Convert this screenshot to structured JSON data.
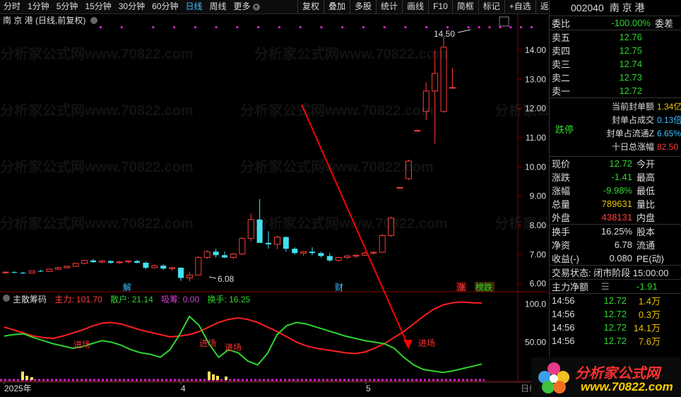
{
  "toolbar": {
    "periods": [
      "分时",
      "1分钟",
      "5分钟",
      "15分钟",
      "30分钟",
      "60分钟",
      "日线",
      "周线",
      "更多"
    ],
    "active_period": "日线",
    "buttons": [
      "复权",
      "叠加",
      "多股",
      "统计",
      "画线",
      "F10",
      "简框",
      "标记",
      "+自选",
      "返回"
    ]
  },
  "chart": {
    "title": "南 京 港 (日线,前复权)",
    "price_ticks": [
      "14.00",
      "13.00",
      "12.00",
      "11.00",
      "10.00",
      "9.00",
      "8.00",
      "7.00",
      "6.00"
    ],
    "high_label": "14.50",
    "low_label": "6.08",
    "markers": [
      "解",
      "财",
      "涨",
      "榜跌"
    ],
    "x_labels": [
      "2025年",
      "4",
      "5",
      "日线"
    ],
    "indicator": {
      "name": "主散筹码",
      "main_force": "主力: 101.70",
      "retail": "散户: 21.14",
      "absorb": "吸筹: 0.00",
      "turnover": "换手: 16.25",
      "ticks": [
        "100.0",
        "50.00"
      ],
      "entry_label": "进场"
    }
  },
  "chart_data": {
    "type": "candlestick",
    "candles": [
      [
        6.38,
        6.42,
        6.35,
        6.4
      ],
      [
        6.4,
        6.43,
        6.36,
        6.38
      ],
      [
        6.38,
        6.41,
        6.34,
        6.37
      ],
      [
        6.37,
        6.45,
        6.36,
        6.44
      ],
      [
        6.44,
        6.48,
        6.4,
        6.42
      ],
      [
        6.42,
        6.52,
        6.41,
        6.5
      ],
      [
        6.5,
        6.58,
        6.47,
        6.55
      ],
      [
        6.55,
        6.62,
        6.52,
        6.6
      ],
      [
        6.6,
        6.72,
        6.58,
        6.7
      ],
      [
        6.7,
        6.82,
        6.66,
        6.8
      ],
      [
        6.8,
        6.85,
        6.72,
        6.74
      ],
      [
        6.74,
        6.82,
        6.7,
        6.78
      ],
      [
        6.78,
        6.8,
        6.68,
        6.72
      ],
      [
        6.72,
        6.78,
        6.68,
        6.75
      ],
      [
        6.75,
        6.8,
        6.7,
        6.78
      ],
      [
        6.78,
        6.82,
        6.7,
        6.72
      ],
      [
        6.72,
        6.76,
        6.5,
        6.55
      ],
      [
        6.55,
        6.66,
        6.52,
        6.62
      ],
      [
        6.62,
        6.66,
        6.48,
        6.52
      ],
      [
        6.52,
        6.58,
        6.45,
        6.55
      ],
      [
        6.55,
        6.56,
        6.1,
        6.2
      ],
      [
        6.2,
        6.4,
        6.08,
        6.3
      ],
      [
        6.3,
        6.95,
        6.28,
        6.9
      ],
      [
        6.9,
        7.15,
        6.85,
        7.1
      ],
      [
        7.1,
        7.2,
        6.9,
        6.98
      ],
      [
        6.98,
        7.1,
        6.88,
        6.9
      ],
      [
        6.9,
        7.05,
        6.85,
        7.02
      ],
      [
        7.02,
        7.6,
        7.0,
        7.55
      ],
      [
        7.55,
        8.4,
        7.45,
        8.2
      ],
      [
        8.2,
        8.9,
        7.5,
        7.4
      ],
      [
        7.4,
        7.8,
        7.2,
        7.35
      ],
      [
        7.35,
        7.65,
        7.18,
        7.6
      ],
      [
        7.6,
        7.62,
        7.1,
        7.2
      ],
      [
        7.2,
        7.25,
        7.0,
        7.05
      ],
      [
        7.05,
        7.12,
        6.95,
        7.1
      ],
      [
        7.1,
        7.25,
        6.98,
        7.05
      ],
      [
        7.05,
        7.1,
        6.9,
        6.95
      ],
      [
        6.95,
        7.05,
        6.75,
        6.8
      ],
      [
        6.8,
        6.92,
        6.76,
        6.9
      ],
      [
        6.9,
        6.98,
        6.85,
        6.95
      ],
      [
        6.95,
        7.0,
        6.88,
        6.98
      ],
      [
        6.98,
        7.1,
        6.95,
        7.05
      ],
      [
        7.05,
        7.12,
        7.0,
        7.08
      ],
      [
        7.08,
        7.7,
        7.05,
        7.65
      ],
      [
        7.65,
        8.3,
        7.6,
        8.25
      ],
      [
        9.3,
        9.32,
        9.28,
        9.3
      ],
      [
        9.6,
        10.25,
        9.55,
        10.2
      ],
      [
        11.25,
        11.28,
        11.22,
        11.25
      ],
      [
        11.9,
        12.9,
        11.6,
        12.6
      ],
      [
        12.6,
        14.0,
        10.8,
        13.2
      ],
      [
        11.9,
        14.45,
        11.85,
        14.1
      ],
      [
        12.72,
        13.4,
        12.72,
        12.72
      ]
    ],
    "price_range": [
      5.8,
      14.7
    ],
    "main_force_series": [
      70,
      66,
      62,
      58,
      56,
      55,
      58,
      62,
      66,
      71,
      75,
      76,
      74,
      70,
      66,
      63,
      60,
      57,
      58,
      60,
      64,
      70,
      76,
      80,
      82,
      80,
      76,
      70,
      64,
      57,
      50,
      45,
      42,
      40,
      38,
      36,
      35,
      37,
      42,
      48,
      56,
      64,
      74,
      84,
      93,
      99,
      102,
      103,
      102,
      101.7
    ],
    "retail_series": [
      58,
      60,
      61,
      56,
      52,
      48,
      45,
      42,
      44,
      48,
      52,
      50,
      46,
      40,
      36,
      34,
      30,
      40,
      60,
      84,
      72,
      48,
      30,
      40,
      36,
      25,
      20,
      35,
      60,
      72,
      76,
      74,
      70,
      66,
      62,
      58,
      55,
      52,
      50,
      48,
      42,
      30,
      20,
      14,
      12,
      10,
      12,
      15,
      18,
      21.14
    ],
    "indicator_range": [
      0,
      110
    ],
    "bars_x": [
      20,
      21,
      22,
      23,
      28,
      29,
      30
    ],
    "x_axis_labels": [
      "2025年",
      "4",
      "5"
    ]
  },
  "right_panel": {
    "code": "002040",
    "name": "南 京 港",
    "weibi_label": "委比",
    "weibi_value": "-100.00%",
    "weicha_label": "委差",
    "asks": [
      {
        "label": "卖五",
        "price": "12.76"
      },
      {
        "label": "卖四",
        "price": "12.75"
      },
      {
        "label": "卖三",
        "price": "12.74"
      },
      {
        "label": "卖二",
        "price": "12.73"
      },
      {
        "label": "卖一",
        "price": "12.72"
      }
    ],
    "limit_down_label": "跌停",
    "seal_rows": [
      {
        "label": "当前封单额",
        "value": "1.34亿"
      },
      {
        "label": "封单占成交",
        "value": "0.13倍"
      },
      {
        "label": "封单占流通Z",
        "value": "6.65%"
      },
      {
        "label": "十日总涨幅",
        "value": "82.50"
      }
    ],
    "quote": [
      {
        "l": "现价",
        "v": "12.72",
        "r": "今开",
        "c": "green"
      },
      {
        "l": "涨跌",
        "v": "-1.41",
        "r": "最高",
        "c": "green"
      },
      {
        "l": "涨幅",
        "v": "-9.98%",
        "r": "最低",
        "c": "green"
      },
      {
        "l": "总量",
        "v": "789631",
        "r": "量比",
        "c": "yellow"
      },
      {
        "l": "外盘",
        "v": "438131",
        "r": "内盘",
        "c": "red"
      }
    ],
    "stats": [
      {
        "l": "换手",
        "v": "16.25%",
        "r": "股本"
      },
      {
        "l": "净资",
        "v": "6.78",
        "r": "流通"
      },
      {
        "l": "收益(-)",
        "v": "0.080",
        "r": "PE(动)"
      }
    ],
    "trade_status": "交易状态: 闭市阶段 15:00:00",
    "net_flow_label": "主力净额",
    "net_flow_value": "-1.91",
    "ticks": [
      {
        "t": "14:56",
        "p": "12.72",
        "v": "1.4万"
      },
      {
        "t": "14:56",
        "p": "12.72",
        "v": "0.3万"
      },
      {
        "t": "14:56",
        "p": "12.72",
        "v": "14.1万"
      },
      {
        "t": "14:56",
        "p": "12.72",
        "v": "7.6万"
      }
    ]
  },
  "watermark": "分析家公式网www.70822.com",
  "logo": {
    "title": "分析家公式网",
    "url": "www.70822.com"
  }
}
